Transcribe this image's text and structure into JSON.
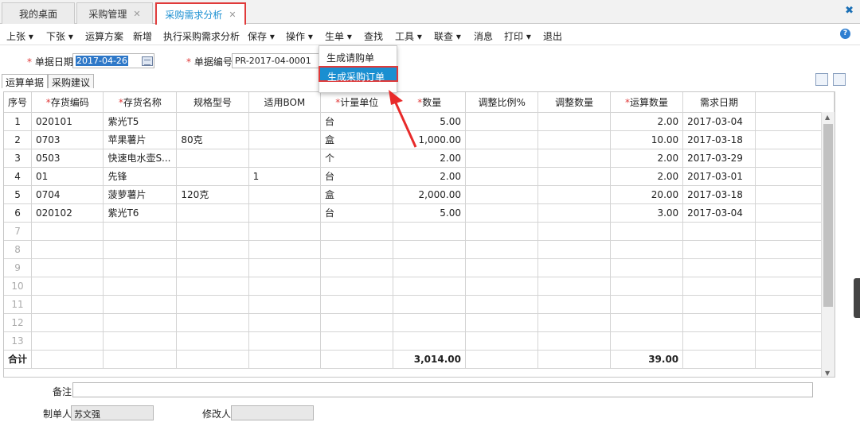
{
  "tabs": [
    {
      "label": "我的桌面",
      "closable": false
    },
    {
      "label": "采购管理",
      "closable": true
    },
    {
      "label": "采购需求分析",
      "closable": true,
      "active": true
    }
  ],
  "toolbar": [
    "上张 ▾",
    "下张 ▾",
    "运算方案",
    "新增",
    "执行采购需求分析",
    "保存 ▾",
    "操作 ▾",
    "生单 ▾",
    "查找",
    "工具 ▾",
    "联查 ▾",
    "消息",
    "打印 ▾",
    "退出"
  ],
  "form": {
    "date_label": "单据日期",
    "date_value": "2017-04-26",
    "code_label": "单据编号",
    "code_value": "PR-2017-04-0001"
  },
  "subtabs": [
    "运算单据",
    "采购建议"
  ],
  "dropdown": {
    "items": [
      "生成请购单",
      "生成采购订单"
    ],
    "active_index": 1
  },
  "columns": [
    "序号",
    "*存货编码",
    "*存货名称",
    "规格型号",
    "适用BOM",
    "*计量单位",
    "*数量",
    "调整比例%",
    "调整数量",
    "*运算数量",
    "需求日期"
  ],
  "rows": [
    {
      "no": "1",
      "code": "020101",
      "name": "紫光T5",
      "spec": "",
      "bom": "",
      "unit": "台",
      "qty": "5.00",
      "ratio": "",
      "adj": "",
      "calc": "2.00",
      "date": "2017-03-04"
    },
    {
      "no": "2",
      "code": "0703",
      "name": "苹果薯片",
      "spec": "80克",
      "bom": "",
      "unit": "盒",
      "qty": "1,000.00",
      "ratio": "",
      "adj": "",
      "calc": "10.00",
      "date": "2017-03-18"
    },
    {
      "no": "3",
      "code": "0503",
      "name": "快速电水壶S...",
      "spec": "",
      "bom": "",
      "unit": "个",
      "qty": "2.00",
      "ratio": "",
      "adj": "",
      "calc": "2.00",
      "date": "2017-03-29"
    },
    {
      "no": "4",
      "code": "01",
      "name": "先锋",
      "spec": "",
      "bom": "1",
      "unit": "台",
      "qty": "2.00",
      "ratio": "",
      "adj": "",
      "calc": "2.00",
      "date": "2017-03-01"
    },
    {
      "no": "5",
      "code": "0704",
      "name": "菠萝薯片",
      "spec": "120克",
      "bom": "",
      "unit": "盒",
      "qty": "2,000.00",
      "ratio": "",
      "adj": "",
      "calc": "20.00",
      "date": "2017-03-18"
    },
    {
      "no": "6",
      "code": "020102",
      "name": "紫光T6",
      "spec": "",
      "bom": "",
      "unit": "台",
      "qty": "5.00",
      "ratio": "",
      "adj": "",
      "calc": "3.00",
      "date": "2017-03-04"
    }
  ],
  "empty_rows": [
    "7",
    "8",
    "9",
    "10",
    "11",
    "12",
    "13"
  ],
  "totals": {
    "label": "合计",
    "qty": "3,014.00",
    "calc": "39.00"
  },
  "footer": {
    "note_label": "备注",
    "maker_label": "制单人",
    "maker_value": "苏文强",
    "modifier_label": "修改人",
    "modifier_value": ""
  }
}
